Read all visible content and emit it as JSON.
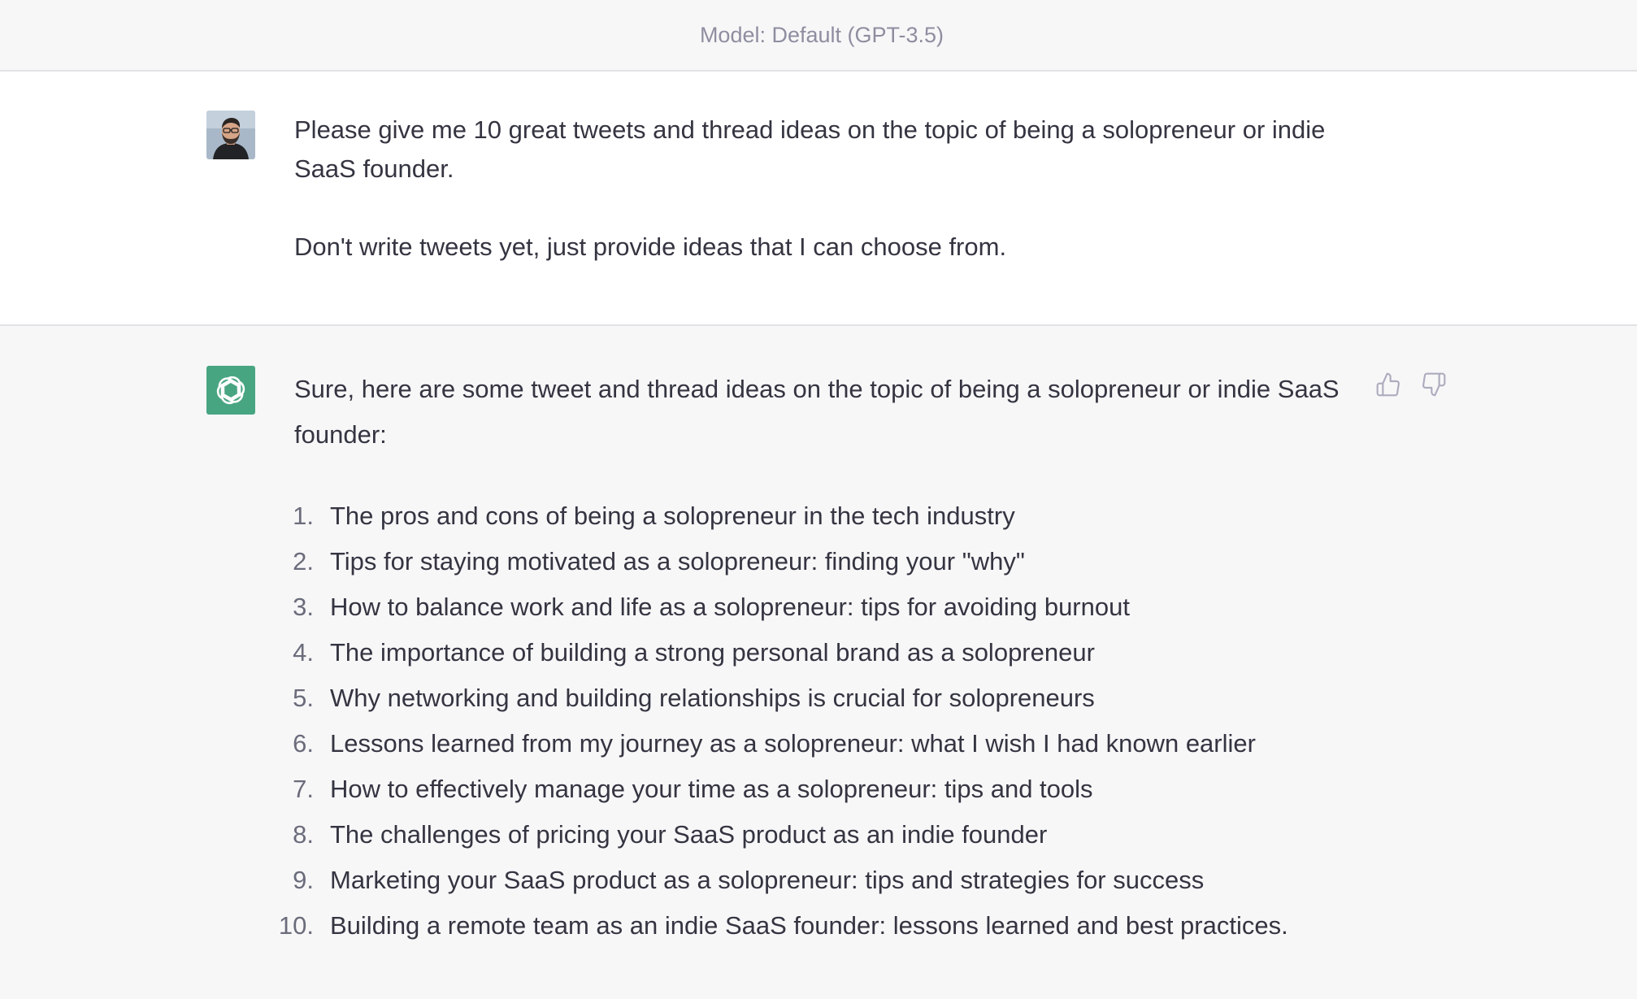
{
  "header": {
    "model_label": "Model: Default (GPT-3.5)"
  },
  "user_message": {
    "avatar": "user-avatar-photo",
    "paragraphs": [
      "Please give me 10 great tweets and thread ideas on the topic of being a solopreneur or indie SaaS founder.",
      "Don't write tweets yet, just provide ideas that I can choose from."
    ]
  },
  "assistant_message": {
    "avatar": "openai-logo-icon",
    "avatar_color": "#48a582",
    "intro": "Sure, here are some tweet and thread ideas on the topic of being a solopreneur or indie SaaS founder:",
    "items": [
      {
        "num": "1.",
        "text": "The pros and cons of being a solopreneur in the tech industry"
      },
      {
        "num": "2.",
        "text": "Tips for staying motivated as a solopreneur: finding your \"why\""
      },
      {
        "num": "3.",
        "text": "How to balance work and life as a solopreneur: tips for avoiding burnout"
      },
      {
        "num": "4.",
        "text": "The importance of building a strong personal brand as a solopreneur"
      },
      {
        "num": "5.",
        "text": "Why networking and building relationships is crucial for solopreneurs"
      },
      {
        "num": "6.",
        "text": "Lessons learned from my journey as a solopreneur: what I wish I had known earlier"
      },
      {
        "num": "7.",
        "text": "How to effectively manage your time as a solopreneur: tips and tools"
      },
      {
        "num": "8.",
        "text": "The challenges of pricing your SaaS product as an indie founder"
      },
      {
        "num": "9.",
        "text": "Marketing your SaaS product as a solopreneur: tips and strategies for success"
      },
      {
        "num": "10.",
        "text": "Building a remote team as an indie SaaS founder: lessons learned and best practices."
      }
    ],
    "feedback": {
      "up_icon": "thumbs-up-icon",
      "down_icon": "thumbs-down-icon"
    }
  }
}
